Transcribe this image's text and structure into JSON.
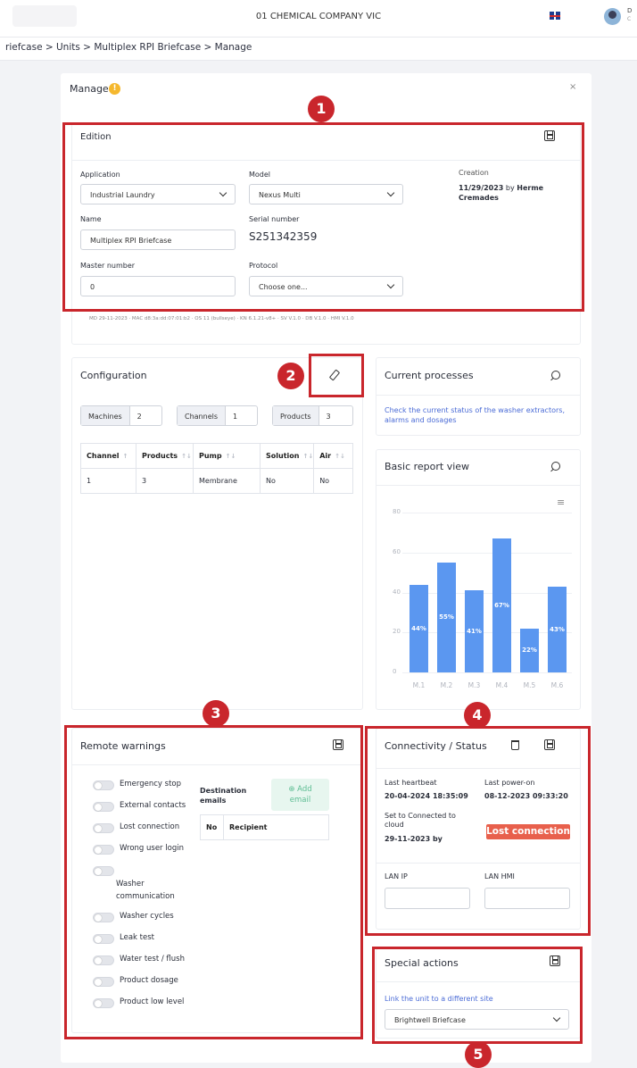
{
  "topbar": {
    "company": "01 CHEMICAL COMPANY VIC",
    "user_initial": "D",
    "user_sub": "C"
  },
  "breadcrumb": "riefcase > Units > Multiplex RPI Briefcase > Manage",
  "manage": {
    "title": "Manage",
    "close": "×"
  },
  "edition": {
    "title": "Edition",
    "application_label": "Application",
    "application_value": "Industrial Laundry",
    "model_label": "Model",
    "model_value": "Nexus Multi",
    "creation_label": "Creation",
    "creation_date": "11/29/2023",
    "creation_by": "by",
    "creation_user": "Herme Cremades",
    "name_label": "Name",
    "name_value": "Multiplex RPI Briefcase",
    "serial_label": "Serial number",
    "serial_value": "S251342359",
    "master_label": "Master number",
    "master_value": "0",
    "protocol_label": "Protocol",
    "protocol_placeholder": "Choose one...",
    "meta": "MD 29-11-2023 · MAC d8:3a:dd:07:01:b2 · OS 11 (bullseye) · KN 6.1.21-v8+ · SV V.1.0 · DB V.1.0 · HMI V.1.0"
  },
  "configuration": {
    "title": "Configuration",
    "machines_label": "Machines",
    "machines_value": "2",
    "channels_label": "Channels",
    "channels_value": "1",
    "products_label": "Products",
    "products_value": "3",
    "columns": [
      "Channel",
      "Products",
      "Pump",
      "Solution",
      "Air"
    ],
    "rows": [
      [
        "1",
        "3",
        "Membrane",
        "No",
        "No"
      ]
    ]
  },
  "current_processes": {
    "title": "Current processes",
    "text": "Check the current status of the washer extractors, alarms and dosages"
  },
  "report": {
    "title": "Basic report view",
    "menu": "≡"
  },
  "chart_data": {
    "type": "bar",
    "categories": [
      "M.1",
      "M.2",
      "M.3",
      "M.4",
      "M.5",
      "M.6"
    ],
    "values": [
      44,
      55,
      41,
      67,
      22,
      43
    ],
    "data_labels": [
      "44%",
      "55%",
      "41%",
      "67%",
      "22%",
      "43%"
    ],
    "yticks": [
      "0",
      "20",
      "40",
      "60",
      "80"
    ],
    "ylim": [
      0,
      80
    ],
    "grid": true,
    "color": "#5b97f0"
  },
  "remote_warnings": {
    "title": "Remote warnings",
    "items": [
      "Emergency stop",
      "External contacts",
      "Lost connection",
      "Wrong user login",
      "Washer communication",
      "Washer cycles",
      "Leak test",
      "Water test / flush",
      "Product dosage",
      "Product low level"
    ],
    "destination_label": "Destination emails",
    "add_email": "⊕ Add email",
    "col_no": "No",
    "col_recipient": "Recipient"
  },
  "connectivity": {
    "title": "Connectivity / Status",
    "last_heartbeat_label": "Last heartbeat",
    "last_heartbeat_value": "20-04-2024 18:35:09",
    "last_poweron_label": "Last power-on",
    "last_poweron_value": "08-12-2023 09:33:20",
    "connected_label": "Set to Connected to cloud",
    "connected_value": "29-11-2023 by",
    "status_badge": "Lost connection",
    "lan_ip_label": "LAN IP",
    "lan_hmi_label": "LAN HMI"
  },
  "special_actions": {
    "title": "Special actions",
    "link": "Link the unit to a different site",
    "site_value": "Brightwell Briefcase"
  },
  "markers": [
    "1",
    "2",
    "3",
    "4",
    "5"
  ],
  "colors": {
    "annotation_red": "#c9262c",
    "bar_blue": "#5b97f0",
    "status_lost": "#e8604c",
    "link_blue": "#4a6bd6",
    "warning_yellow": "#f5b82e"
  }
}
